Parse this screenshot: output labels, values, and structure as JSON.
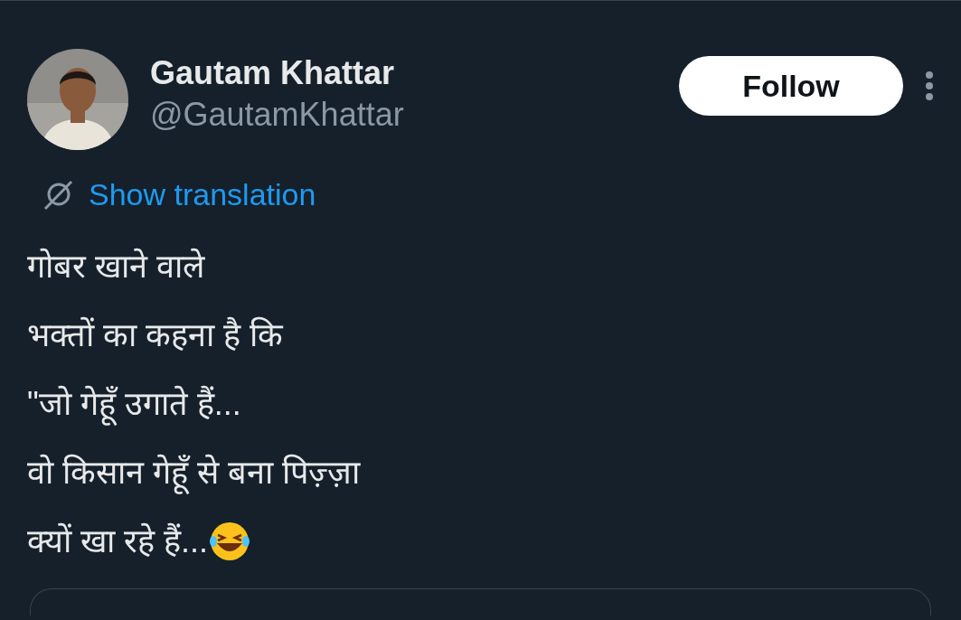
{
  "author": {
    "name": "Gautam Khattar",
    "handle": "@GautamKhattar"
  },
  "follow_button": {
    "label": "Follow"
  },
  "translation_link": {
    "label": "Show translation"
  },
  "tweet_lines": [
    "गोबर खाने वाले",
    "भक्तों का कहना है कि",
    "\"जो गेहूँ उगाते हैं...",
    "वो किसान गेहूँ से बना पिज़्ज़ा",
    "क्यों खा रहे हैं..."
  ]
}
